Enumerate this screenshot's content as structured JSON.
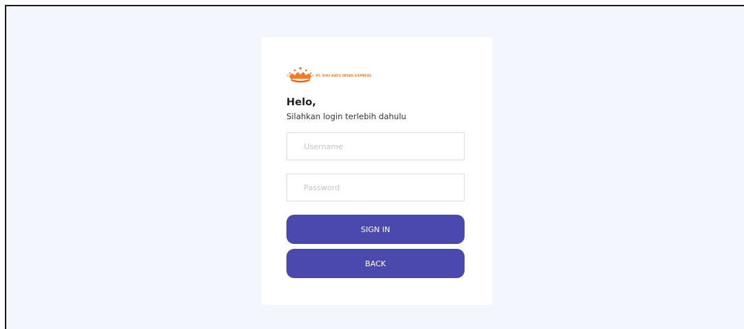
{
  "login": {
    "logo_alt": "crown-logo",
    "company_name": "PT. KIKI RATU INTAN EXPRESS",
    "greeting": "Helo,",
    "subtitle": "Silahkan login terlebih dahulu",
    "username": {
      "placeholder": "Username",
      "value": ""
    },
    "password": {
      "placeholder": "Password",
      "value": ""
    },
    "signin_label": "SIGN IN",
    "back_label": "BACK"
  },
  "colors": {
    "page_background": "#f3f6fd",
    "card_background": "#ffffff",
    "button": "#4c49ae",
    "logo_orange": "#f07a2a"
  }
}
